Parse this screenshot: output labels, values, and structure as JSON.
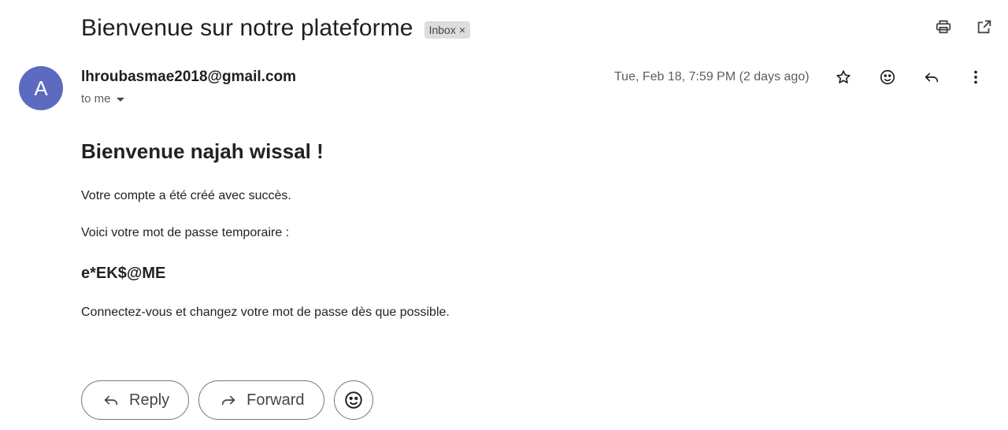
{
  "email": {
    "subject": "Bienvenue sur notre plateforme",
    "label": "Inbox",
    "label_remove_glyph": "×",
    "sender": "lhroubasmae2018@gmail.com",
    "avatar_letter": "A",
    "recipient": "to me",
    "date": "Tue, Feb 18, 7:59 PM (2 days ago)",
    "body": {
      "heading": "Bienvenue najah wissal !",
      "line1": "Votre compte a été créé avec succès.",
      "line2": "Voici votre mot de passe temporaire :",
      "password": "e*EK$@ME",
      "line3": "Connectez-vous et changez votre mot de passe dès que possible."
    }
  },
  "actions": {
    "reply_label": "Reply",
    "forward_label": "Forward"
  },
  "icons": {
    "top": [
      "print-icon",
      "open-in-new-window-icon"
    ],
    "message": [
      "star-icon",
      "emoji-icon",
      "reply-icon",
      "more-vert-icon"
    ]
  },
  "colors": {
    "avatar_bg": "#5c6bc0",
    "chip_bg": "#dddddd",
    "text": "#1f1f1f",
    "muted": "#5e5e5e"
  }
}
